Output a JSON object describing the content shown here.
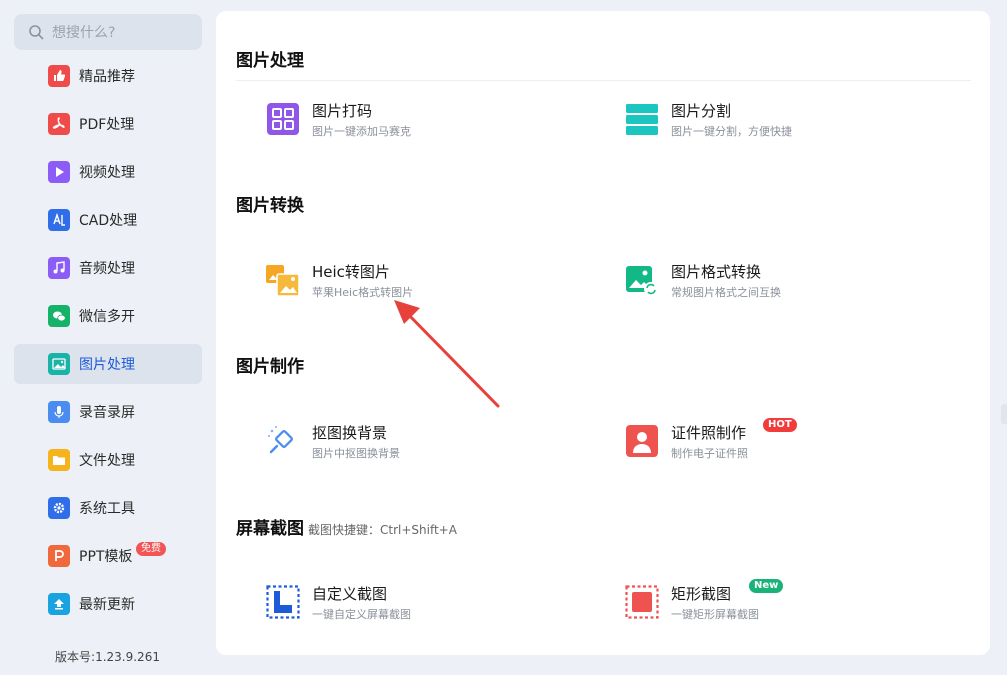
{
  "search": {
    "placeholder": "想搜什么?"
  },
  "sidebar": {
    "items": [
      {
        "label": "精品推荐",
        "icon": "thumbs-up-icon",
        "color": "#ef4b4b"
      },
      {
        "label": "PDF处理",
        "icon": "pdf-icon",
        "color": "#ef4b4b"
      },
      {
        "label": "视频处理",
        "icon": "play-icon",
        "color": "#8b5cf6"
      },
      {
        "label": "CAD处理",
        "icon": "cad-icon",
        "color": "#2f6ee8"
      },
      {
        "label": "音频处理",
        "icon": "music-icon",
        "color": "#8b5cf6"
      },
      {
        "label": "微信多开",
        "icon": "wechat-icon",
        "color": "#16b26a"
      },
      {
        "label": "图片处理",
        "icon": "image-icon",
        "color": "#19b3a8",
        "active": true
      },
      {
        "label": "录音录屏",
        "icon": "microphone-icon",
        "color": "#4a8cf0"
      },
      {
        "label": "文件处理",
        "icon": "folder-icon",
        "color": "#f5b31c"
      },
      {
        "label": "系统工具",
        "icon": "gear-icon",
        "color": "#2f6ee8"
      },
      {
        "label": "PPT模板",
        "icon": "ppt-icon",
        "color": "#f0683c",
        "badge": "免费"
      },
      {
        "label": "最新更新",
        "icon": "upload-icon",
        "color": "#19a3e0"
      }
    ],
    "version": "版本号:1.23.9.261"
  },
  "main": {
    "sections": [
      {
        "title": "图片处理",
        "tools": [
          {
            "name": "图片打码",
            "desc": "图片一键添加马赛克",
            "icon": "mosaic-icon"
          },
          {
            "name": "图片分割",
            "desc": "图片一键分割，方便快捷",
            "icon": "split-icon"
          }
        ]
      },
      {
        "title": "图片转换",
        "tools": [
          {
            "name": "Heic转图片",
            "desc": "苹果Heic格式转图片",
            "icon": "heic-convert-icon"
          },
          {
            "name": "图片格式转换",
            "desc": "常规图片格式之间互换",
            "icon": "format-convert-icon"
          }
        ]
      },
      {
        "title": "图片制作",
        "tools": [
          {
            "name": "抠图换背景",
            "desc": "图片中抠图换背景",
            "icon": "cutout-icon"
          },
          {
            "name": "证件照制作",
            "desc": "制作电子证件照",
            "icon": "id-photo-icon",
            "tag": "HOT"
          }
        ]
      },
      {
        "title": "屏幕截图",
        "hint": "截图快捷键：Ctrl+Shift+A",
        "tools": [
          {
            "name": "自定义截图",
            "desc": "一键自定义屏幕截图",
            "icon": "custom-screenshot-icon"
          },
          {
            "name": "矩形截图",
            "desc": "一键矩形屏幕截图",
            "icon": "rect-screenshot-icon",
            "tag": "New"
          }
        ]
      }
    ]
  },
  "colors": {
    "accent": "#1e5bd8",
    "arrow": "#e8403a",
    "hot": "#f23c3c",
    "new": "#19b37a"
  }
}
